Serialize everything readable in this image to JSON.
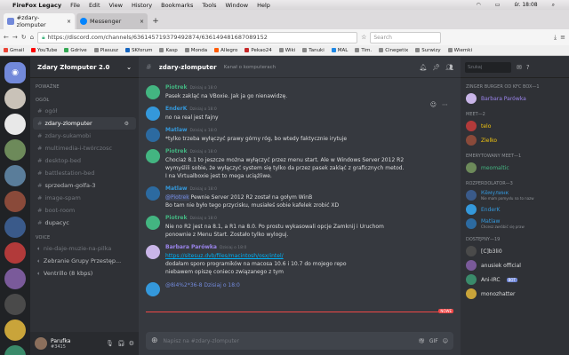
{
  "os_menubar": {
    "items": [
      "FireFox Legacy",
      "File",
      "Edit",
      "View",
      "History",
      "Bookmarks",
      "Tools",
      "Window",
      "Help"
    ],
    "clock": "śr. 18:08",
    "wifi": "wifi",
    "battery": "battery"
  },
  "browser": {
    "tabs": [
      {
        "label": "#zdary-zlomputer"
      },
      {
        "label": "Messenger"
      }
    ],
    "new_tab": "+",
    "url": "https://discord.com/channels/636145719379492874/636149481687089152",
    "search_placeholder": "Search",
    "bookmarks": [
      "Gmail",
      "YouTube",
      "Gdrive",
      "Plasusz",
      "SKforum",
      "Kasp",
      "Monda",
      "Allegro",
      "Pekao24",
      "Wiki",
      "Tanuki",
      "MAL",
      "Tim.",
      "Cinegetix",
      "Surwizy",
      "Wiemki"
    ]
  },
  "server": {
    "name": "Zdary Złomputer 2.0",
    "categories": [
      {
        "label": "POWAŻNE"
      },
      {
        "label": "OGÓŁ"
      },
      {
        "label": "VOICE"
      }
    ],
    "channels": [
      {
        "name": "ogół",
        "state": "muted"
      },
      {
        "name": "zdary-zlomputer",
        "state": "active"
      },
      {
        "name": "zdary-sukamobi",
        "state": "muted"
      },
      {
        "name": "multimedia-i-twórczosc",
        "state": "muted"
      },
      {
        "name": "desktop-bed",
        "state": "muted"
      },
      {
        "name": "battlestation-bed",
        "state": "muted"
      },
      {
        "name": "sprzedam-golfa-3",
        "state": "bright"
      },
      {
        "name": "image-spam",
        "state": "muted"
      },
      {
        "name": "boot-room",
        "state": "muted"
      },
      {
        "name": "dupacyc",
        "state": "bright"
      }
    ],
    "voice": [
      {
        "name": "nie-daje-muzie-na-pilka"
      },
      {
        "name": "Zebranie Grupy Przestęp..."
      },
      {
        "name": "Ventrillo (8 kbps)"
      }
    ]
  },
  "user": {
    "name": "Parufka",
    "tag": "#3415"
  },
  "channel_header": {
    "name": "zdary-zlomputer",
    "topic": "Kanał o komputerach"
  },
  "messages": [
    {
      "author": "Piotrek",
      "time": "Dzisiaj o 18:0",
      "color": "green",
      "lines": [
        "Pasek zakląć na VBoxie. Jak ja go nienawidzę."
      ]
    },
    {
      "author": "EnderK",
      "time": "Dzisiaj o 18:0",
      "color": "blue",
      "lines": [
        "no na real jest fajny"
      ]
    },
    {
      "author": "Matlaw",
      "time": "Dzisiaj o 18:0",
      "color": "blue",
      "lines": [
        "*tylko trzeba wyłączyć prawy górny róg, bo wtedy faktycznie irytuje"
      ]
    },
    {
      "author": "Piotrek",
      "time": "Dzisiaj o 18:0",
      "color": "green",
      "lines": [
        "Chociaż 8.1 to jeszcze można wyłączyć przez menu start. Ale w Windows Server 2012 R2",
        "wymyślili sobie, że wyłączyć system się tylko da przez pasek zakląć z graficznych metod.",
        "I na Virtualboxie jest to mega uciążliwe."
      ]
    },
    {
      "author": "Matlaw",
      "time": "Dzisiaj o 18:0",
      "color": "blue",
      "mention": "@Piotrek",
      "lines": [
        "Pewnie Server 2012 R2 został na gołym WinB",
        "Bo tam nie było tego przycisku, musiałeś sobie kafelek zrobić XD"
      ]
    },
    {
      "author": "Piotrek",
      "time": "Dzisiaj o 18:0",
      "color": "green",
      "lines": [
        "Nie no R2 jest na 8.1, a R1 na 8.0. Po prostu wykasowali opcje Zamknij i Uruchom",
        "ponownie z Menu Start. Zostało tylko wyloguj."
      ]
    },
    {
      "author": "Barbara Parówka",
      "time": "Dzisiaj o 18:0",
      "color": "purple",
      "link": "https://sitesuz.dvb/files/macintosh/osx/intel/",
      "lines": [
        "dodałam sporo programików na macosa 10.6 i 10.7 do mojego repo",
        "niebawem opiszę conieco związanego z tym"
      ]
    },
    {
      "author": "",
      "time": "",
      "color": "blue",
      "lines": [
        "@8i4%2*36-8 Dzisiaj o 18:0"
      ]
    }
  ],
  "new_badge": "NOWE",
  "composer": {
    "placeholder": "Napisz na #zdary-zlomputer",
    "gif": "GIF"
  },
  "members": {
    "search_placeholder": "Szukaj",
    "groups": [
      {
        "role": "ZINGER BURGER OD KFC BOX—1",
        "members": [
          {
            "name": "Barbara Parówka",
            "color": "#9b84ec"
          }
        ]
      },
      {
        "role": "MEET—2",
        "members": [
          {
            "name": "telo",
            "color": "#f1c40f"
          },
          {
            "name": "Zielko",
            "color": "#f1c40f"
          }
        ]
      },
      {
        "role": "EMERYTOWANY MEET—1",
        "members": [
          {
            "name": "meomaltic",
            "color": "#43b581"
          }
        ]
      },
      {
        "role": "ROZPERDOLATOR—3",
        "members": [
          {
            "name": "Кёмулинк",
            "color": "#3498db",
            "sub": "Nie mam pomysłu na to nazw"
          },
          {
            "name": "EnderK",
            "color": "#3498db"
          },
          {
            "name": "Matlaw",
            "color": "#3498db",
            "sub": "Chcesz zwróbić się praw"
          }
        ]
      },
      {
        "role": "DOSTĘPNY—19",
        "members": [
          {
            "name": "[C]b3li0",
            "color": "#dcddde"
          },
          {
            "name": "anusiek official",
            "color": "#dcddde"
          },
          {
            "name": "Ani-IRC",
            "color": "#dcddde",
            "bot": "BOT"
          },
          {
            "name": "monozhatter",
            "color": "#dcddde"
          }
        ]
      }
    ]
  }
}
